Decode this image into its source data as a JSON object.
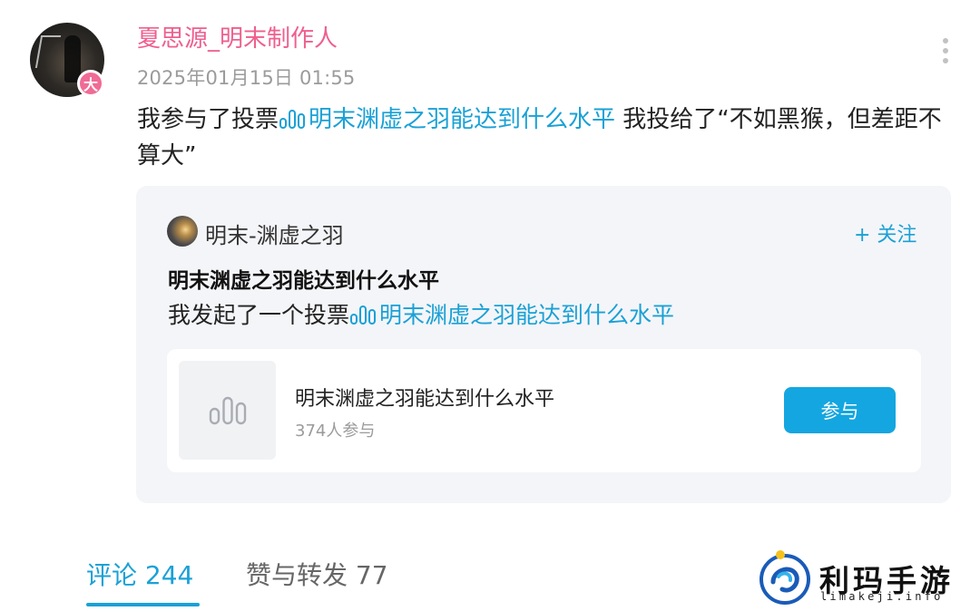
{
  "post": {
    "author": "夏思源_明末制作人",
    "avatar_badge": "大",
    "timestamp": "2025年01月15日 01:55",
    "text_prefix": "我参与了投票",
    "vote_link": "明末渊虚之羽能达到什么水平",
    "text_suffix": " 我投给了“不如黑猴，但差距不算大”"
  },
  "card": {
    "author": "明末-渊虚之羽",
    "follow_label": "+ 关注",
    "title": "明末渊虚之羽能达到什么水平",
    "body_prefix": "我发起了一个投票",
    "body_link": "明末渊虚之羽能达到什么水平",
    "poll": {
      "title": "明末渊虚之羽能达到什么水平",
      "participants": "374人参与",
      "join_label": "参与"
    }
  },
  "tabs": {
    "comments": "评论 244",
    "likes_reposts": "赞与转发 77"
  },
  "watermark": {
    "title": "利玛手游",
    "url": "limakeji.info"
  },
  "icons": {
    "more": "more-vertical-icon",
    "vote": "poll-bars-icon",
    "plus": "plus-icon"
  },
  "colors": {
    "author": "#ef5f8e",
    "link": "#1aa1d6",
    "button": "#14a6e0",
    "card_bg": "#f4f5f8"
  }
}
